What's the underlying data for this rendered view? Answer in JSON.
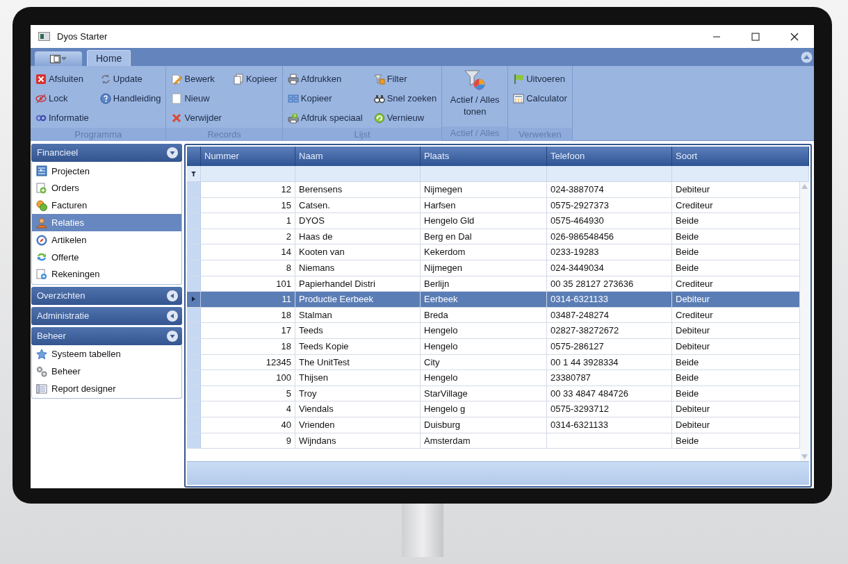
{
  "window": {
    "title": "Dyos Starter"
  },
  "ribbon": {
    "tabs": [
      {
        "label": "Home",
        "selected": true
      }
    ],
    "groups": [
      {
        "label": "Programma",
        "items": [
          {
            "label": "Afsluiten",
            "kind": "small"
          },
          {
            "label": "Lock",
            "kind": "small"
          },
          {
            "label": "Informatie",
            "kind": "small"
          },
          {
            "label": "Update",
            "kind": "small"
          },
          {
            "label": "Handleiding",
            "kind": "small"
          }
        ]
      },
      {
        "label": "Records",
        "items": [
          {
            "label": "Bewerk",
            "kind": "small"
          },
          {
            "label": "Nieuw",
            "kind": "small"
          },
          {
            "label": "Verwijder",
            "kind": "small"
          },
          {
            "label": "Kopieer",
            "kind": "small"
          }
        ]
      },
      {
        "label": "Lijst",
        "items": [
          {
            "label": "Afdrukken",
            "kind": "small"
          },
          {
            "label": "Kopieer",
            "kind": "small"
          },
          {
            "label": "Afdruk speciaal",
            "kind": "small"
          },
          {
            "label": "Filter",
            "kind": "small"
          },
          {
            "label": "Snel zoeken",
            "kind": "small"
          },
          {
            "label": "Vernieuw",
            "kind": "small"
          }
        ]
      },
      {
        "label": "Actief / Alles",
        "items": [
          {
            "label": "Actief / Alles tonen",
            "kind": "large"
          }
        ]
      },
      {
        "label": "Verwerken",
        "items": [
          {
            "label": "Uitvoeren",
            "kind": "small"
          },
          {
            "label": "Calculator",
            "kind": "small"
          }
        ]
      }
    ]
  },
  "sidebar": {
    "sections": [
      {
        "label": "Financieel",
        "expanded": true,
        "items": [
          {
            "label": "Projecten",
            "selected": false
          },
          {
            "label": "Orders",
            "selected": false
          },
          {
            "label": "Facturen",
            "selected": false
          },
          {
            "label": "Relaties",
            "selected": true
          },
          {
            "label": "Artikelen",
            "selected": false
          },
          {
            "label": "Offerte",
            "selected": false
          },
          {
            "label": "Rekeningen",
            "selected": false
          }
        ]
      },
      {
        "label": "Overzichten",
        "expanded": false
      },
      {
        "label": "Administratie",
        "expanded": false
      },
      {
        "label": "Beheer",
        "expanded": true,
        "items": [
          {
            "label": "Systeem tabellen",
            "selected": false
          },
          {
            "label": "Beheer",
            "selected": false
          },
          {
            "label": "Report designer",
            "selected": false
          }
        ]
      }
    ]
  },
  "table": {
    "columns": [
      {
        "label": "Nummer"
      },
      {
        "label": "Naam"
      },
      {
        "label": "Plaats"
      },
      {
        "label": "Telefoon"
      },
      {
        "label": "Soort"
      }
    ],
    "rows": [
      {
        "nummer": "12",
        "naam": "Berensens",
        "plaats": "Nijmegen",
        "telefoon": "024-3887074",
        "soort": "Debiteur",
        "selected": false
      },
      {
        "nummer": "15",
        "naam": "Catsen.",
        "plaats": "Harfsen",
        "telefoon": "0575-2927373",
        "soort": "Crediteur",
        "selected": false
      },
      {
        "nummer": "1",
        "naam": "DYOS",
        "plaats": "Hengelo Gld",
        "telefoon": "0575-464930",
        "soort": "Beide",
        "selected": false
      },
      {
        "nummer": "2",
        "naam": "Haas de",
        "plaats": "Berg en Dal",
        "telefoon": "026-986548456",
        "soort": "Beide",
        "selected": false
      },
      {
        "nummer": "14",
        "naam": "Kooten van",
        "plaats": "Kekerdom",
        "telefoon": "0233-19283",
        "soort": "Beide",
        "selected": false
      },
      {
        "nummer": "8",
        "naam": "Niemans",
        "plaats": "Nijmegen",
        "telefoon": "024-3449034",
        "soort": "Beide",
        "selected": false
      },
      {
        "nummer": "101",
        "naam": "Papierhandel Distri",
        "plaats": "Berlijn",
        "telefoon": "00 35 28127 273636",
        "soort": "Crediteur",
        "selected": false
      },
      {
        "nummer": "11",
        "naam": "Productie Eerbeek",
        "plaats": "Eerbeek",
        "telefoon": "0314-6321133",
        "soort": "Debiteur",
        "selected": true
      },
      {
        "nummer": "18",
        "naam": "Stalman",
        "plaats": "Breda",
        "telefoon": "03487-248274",
        "soort": "Crediteur",
        "selected": false
      },
      {
        "nummer": "17",
        "naam": "Teeds",
        "plaats": "Hengelo",
        "telefoon": "02827-38272672",
        "soort": "Debiteur",
        "selected": false
      },
      {
        "nummer": "18",
        "naam": "Teeds Kopie",
        "plaats": "Hengelo",
        "telefoon": "0575-286127",
        "soort": "Debiteur",
        "selected": false
      },
      {
        "nummer": "12345",
        "naam": "The UnitTest",
        "plaats": "City",
        "telefoon": "00 1 44 3928334",
        "soort": "Beide",
        "selected": false
      },
      {
        "nummer": "100",
        "naam": "Thijsen",
        "plaats": "Hengelo",
        "telefoon": "23380787",
        "soort": "Beide",
        "selected": false
      },
      {
        "nummer": "5",
        "naam": "Troy",
        "plaats": "StarVillage",
        "telefoon": "00 33 4847 484726",
        "soort": "Beide",
        "selected": false
      },
      {
        "nummer": "4",
        "naam": "Viendals",
        "plaats": "Hengelo g",
        "telefoon": "0575-3293712",
        "soort": "Debiteur",
        "selected": false
      },
      {
        "nummer": "40",
        "naam": "Vrienden",
        "plaats": "Duisburg",
        "telefoon": "0314-6321133",
        "soort": "Debiteur",
        "selected": false
      },
      {
        "nummer": "9",
        "naam": "Wijndans",
        "plaats": "Amsterdam",
        "soort": "Beide",
        "selected": false
      }
    ]
  }
}
